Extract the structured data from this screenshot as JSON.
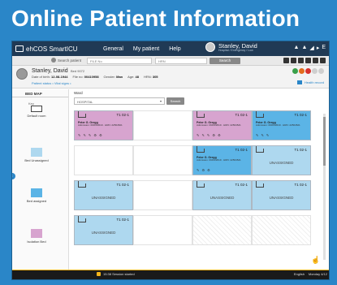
{
  "slide_title": "Online Patient Information",
  "topbar": {
    "app_name": "ehCOS SmartICU",
    "nav": [
      "General",
      "My patient",
      "Help"
    ],
    "user_name": "Stanley, David",
    "user_sub": "Hospital / Emergency / Low",
    "tools": [
      "▲",
      "▲",
      "◢",
      "▸",
      "E"
    ]
  },
  "search": {
    "label": "Search patient",
    "file_placeholder": "FILE No",
    "hrn_placeholder": "HRN",
    "button": "Search"
  },
  "patient": {
    "name": "Stanley, David",
    "bed": "Bed 9072",
    "dob_label": "Date of birth:",
    "dob": "12-08-1944",
    "file_label": "File no:",
    "file_no": "00410958",
    "gender_label": "Gender:",
    "gender": "Man",
    "age_label": "Age:",
    "age": "48",
    "hrn_label": "HRN:",
    "hrn": "305",
    "line3": "Patient status  •  Vital signs  •",
    "history": "Health record",
    "status_colors": [
      "#3aa04a",
      "#e26b1c",
      "#d8312c",
      "#cfcfcf",
      "#cfcfcf"
    ]
  },
  "bedmap": {
    "tab": "BED MAP",
    "key": "Key",
    "legend": [
      {
        "label": "Default room",
        "color": "#ffffff"
      },
      {
        "label": "Bed Unassigned",
        "color": "#aed8ef"
      },
      {
        "label": "Bed assigned",
        "color": "#5bb4e6"
      },
      {
        "label": "Isolation Bed",
        "color": "#d7a4cf"
      }
    ],
    "ward_label": "Ward",
    "ward_value": "HOSPITAL",
    "ward_button": "Search",
    "cells": [
      {
        "id": "T1 02-1",
        "type": "isolation",
        "patient": "Peter G. Gregg",
        "details": "Admission: 09/04/2019 · HRN: 22564521",
        "actions": "✎ ✎ ✎ ⚙ ⚙"
      },
      {
        "id": "",
        "type": "empty"
      },
      {
        "id": "T1 02-1",
        "type": "isolation",
        "patient": "Peter G. Gregg",
        "details": "Admission: 09/04/2019 · HRN: 22564521",
        "actions": "✎ ✎ ✎ ⚙ ⚙"
      },
      {
        "id": "T1 02-1",
        "type": "assigned",
        "patient": "Peter G. Gregg",
        "details": "Admission: 09/04/2019 · HRN: 22564521",
        "actions": "✎ ✎ ✎"
      },
      {
        "id": "",
        "type": "empty"
      },
      {
        "id": "",
        "type": "empty"
      },
      {
        "id": "T1 02-1",
        "type": "assigned",
        "patient": "Peter G. Gregg",
        "details": "Admission: 09/04/2019 · HRN: 22564521",
        "actions": "✎ ⚙ ⚙"
      },
      {
        "id": "T1 02-1",
        "type": "unassigned",
        "label": "UNASSIGNED"
      },
      {
        "id": "T1 02-1",
        "type": "unassigned",
        "label": "UNASSIGNED"
      },
      {
        "id": "",
        "type": "empty"
      },
      {
        "id": "T1 02-1",
        "type": "unassigned",
        "label": "UNASSIGNED"
      },
      {
        "id": "T1 02-1",
        "type": "unassigned",
        "label": "UNASSIGNED"
      },
      {
        "id": "T1 02-1",
        "type": "unassigned",
        "label": "UNASSIGNED"
      },
      {
        "id": "",
        "type": "empty"
      },
      {
        "id": "",
        "type": "hatch"
      },
      {
        "id": "",
        "type": "hatch"
      }
    ]
  },
  "status": {
    "session": "15:38 Session started",
    "language": "English",
    "date": "Monday 4/12"
  }
}
